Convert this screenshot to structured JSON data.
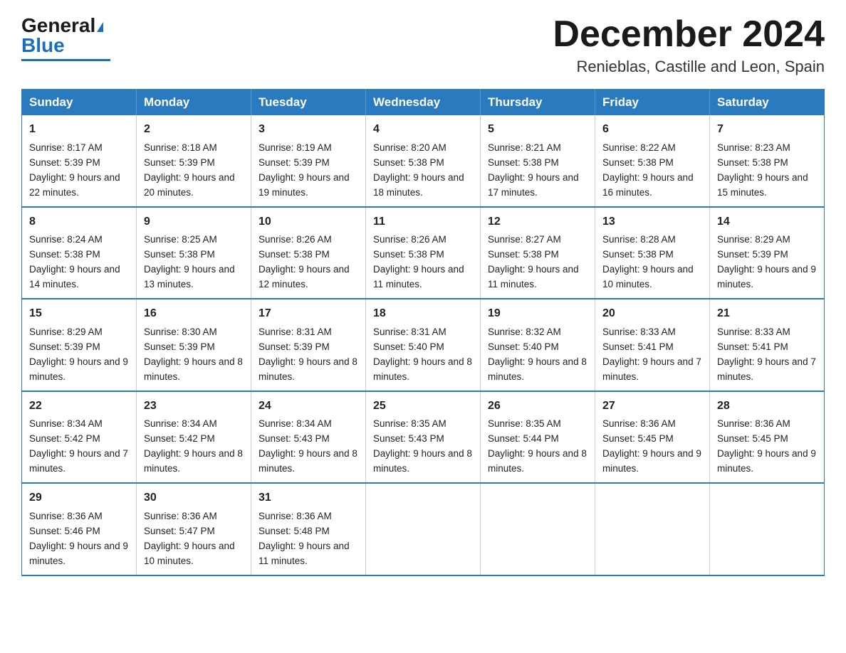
{
  "header": {
    "logo_general": "General",
    "logo_blue": "Blue",
    "month_title": "December 2024",
    "location": "Renieblas, Castille and Leon, Spain"
  },
  "weekdays": [
    "Sunday",
    "Monday",
    "Tuesday",
    "Wednesday",
    "Thursday",
    "Friday",
    "Saturday"
  ],
  "weeks": [
    [
      {
        "day": "1",
        "sunrise": "8:17 AM",
        "sunset": "5:39 PM",
        "daylight": "9 hours and 22 minutes."
      },
      {
        "day": "2",
        "sunrise": "8:18 AM",
        "sunset": "5:39 PM",
        "daylight": "9 hours and 20 minutes."
      },
      {
        "day": "3",
        "sunrise": "8:19 AM",
        "sunset": "5:39 PM",
        "daylight": "9 hours and 19 minutes."
      },
      {
        "day": "4",
        "sunrise": "8:20 AM",
        "sunset": "5:38 PM",
        "daylight": "9 hours and 18 minutes."
      },
      {
        "day": "5",
        "sunrise": "8:21 AM",
        "sunset": "5:38 PM",
        "daylight": "9 hours and 17 minutes."
      },
      {
        "day": "6",
        "sunrise": "8:22 AM",
        "sunset": "5:38 PM",
        "daylight": "9 hours and 16 minutes."
      },
      {
        "day": "7",
        "sunrise": "8:23 AM",
        "sunset": "5:38 PM",
        "daylight": "9 hours and 15 minutes."
      }
    ],
    [
      {
        "day": "8",
        "sunrise": "8:24 AM",
        "sunset": "5:38 PM",
        "daylight": "9 hours and 14 minutes."
      },
      {
        "day": "9",
        "sunrise": "8:25 AM",
        "sunset": "5:38 PM",
        "daylight": "9 hours and 13 minutes."
      },
      {
        "day": "10",
        "sunrise": "8:26 AM",
        "sunset": "5:38 PM",
        "daylight": "9 hours and 12 minutes."
      },
      {
        "day": "11",
        "sunrise": "8:26 AM",
        "sunset": "5:38 PM",
        "daylight": "9 hours and 11 minutes."
      },
      {
        "day": "12",
        "sunrise": "8:27 AM",
        "sunset": "5:38 PM",
        "daylight": "9 hours and 11 minutes."
      },
      {
        "day": "13",
        "sunrise": "8:28 AM",
        "sunset": "5:38 PM",
        "daylight": "9 hours and 10 minutes."
      },
      {
        "day": "14",
        "sunrise": "8:29 AM",
        "sunset": "5:39 PM",
        "daylight": "9 hours and 9 minutes."
      }
    ],
    [
      {
        "day": "15",
        "sunrise": "8:29 AM",
        "sunset": "5:39 PM",
        "daylight": "9 hours and 9 minutes."
      },
      {
        "day": "16",
        "sunrise": "8:30 AM",
        "sunset": "5:39 PM",
        "daylight": "9 hours and 8 minutes."
      },
      {
        "day": "17",
        "sunrise": "8:31 AM",
        "sunset": "5:39 PM",
        "daylight": "9 hours and 8 minutes."
      },
      {
        "day": "18",
        "sunrise": "8:31 AM",
        "sunset": "5:40 PM",
        "daylight": "9 hours and 8 minutes."
      },
      {
        "day": "19",
        "sunrise": "8:32 AM",
        "sunset": "5:40 PM",
        "daylight": "9 hours and 8 minutes."
      },
      {
        "day": "20",
        "sunrise": "8:33 AM",
        "sunset": "5:41 PM",
        "daylight": "9 hours and 7 minutes."
      },
      {
        "day": "21",
        "sunrise": "8:33 AM",
        "sunset": "5:41 PM",
        "daylight": "9 hours and 7 minutes."
      }
    ],
    [
      {
        "day": "22",
        "sunrise": "8:34 AM",
        "sunset": "5:42 PM",
        "daylight": "9 hours and 7 minutes."
      },
      {
        "day": "23",
        "sunrise": "8:34 AM",
        "sunset": "5:42 PM",
        "daylight": "9 hours and 8 minutes."
      },
      {
        "day": "24",
        "sunrise": "8:34 AM",
        "sunset": "5:43 PM",
        "daylight": "9 hours and 8 minutes."
      },
      {
        "day": "25",
        "sunrise": "8:35 AM",
        "sunset": "5:43 PM",
        "daylight": "9 hours and 8 minutes."
      },
      {
        "day": "26",
        "sunrise": "8:35 AM",
        "sunset": "5:44 PM",
        "daylight": "9 hours and 8 minutes."
      },
      {
        "day": "27",
        "sunrise": "8:36 AM",
        "sunset": "5:45 PM",
        "daylight": "9 hours and 9 minutes."
      },
      {
        "day": "28",
        "sunrise": "8:36 AM",
        "sunset": "5:45 PM",
        "daylight": "9 hours and 9 minutes."
      }
    ],
    [
      {
        "day": "29",
        "sunrise": "8:36 AM",
        "sunset": "5:46 PM",
        "daylight": "9 hours and 9 minutes."
      },
      {
        "day": "30",
        "sunrise": "8:36 AM",
        "sunset": "5:47 PM",
        "daylight": "9 hours and 10 minutes."
      },
      {
        "day": "31",
        "sunrise": "8:36 AM",
        "sunset": "5:48 PM",
        "daylight": "9 hours and 11 minutes."
      },
      null,
      null,
      null,
      null
    ]
  ]
}
